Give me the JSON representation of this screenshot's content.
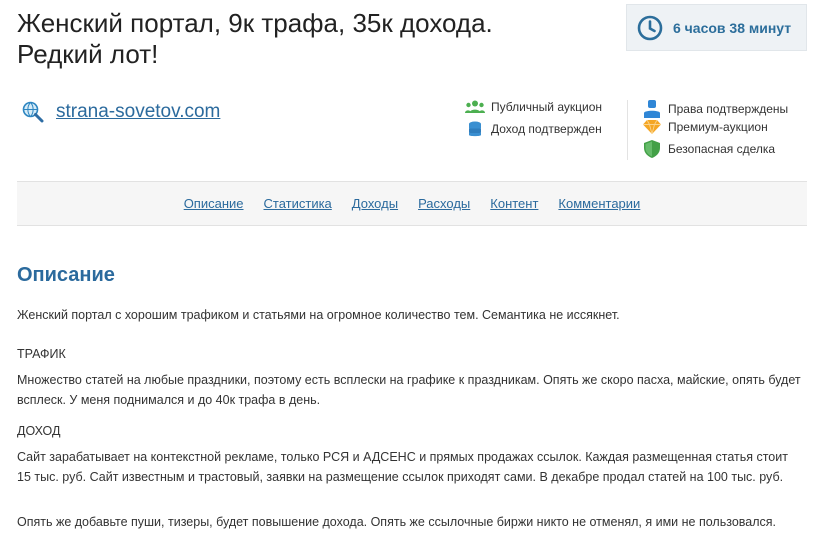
{
  "lot": {
    "title_line1": "Женский портал, 9к трафа, 35к дохода.",
    "title_line2": "Редкий лот!"
  },
  "timer": {
    "text": "6 часов 38 минут",
    "icon": "clock-icon"
  },
  "domain": {
    "link": "strana-sovetov.com",
    "icon": "globe-search-icon"
  },
  "features_left": [
    {
      "label": "Публичный аукцион",
      "icon": "users-icon"
    },
    {
      "label": "Доход подтвержден",
      "icon": "coins-icon"
    }
  ],
  "features_right": [
    {
      "label": "Права подтверждены",
      "icon": "user-icon"
    },
    {
      "label": "Премиум-аукцион",
      "icon": "diamond-icon"
    },
    {
      "label": "Безопасная сделка",
      "icon": "shield-icon"
    }
  ],
  "tabs": [
    "Описание",
    "Статистика",
    "Доходы",
    "Расходы",
    "Контент",
    "Комментарии"
  ],
  "description": {
    "heading": "Описание",
    "intro": "Женский портал с хорошим трафиком и статьями на огромное количество тем. Семантика не иссякнет.",
    "traffic_heading": "ТРАФИК",
    "traffic_text": "Множество статей на любые праздники, поэтому есть всплески на графике к праздникам. Опять же скоро пасха, майские, опять будет всплеск. У меня поднимался и до 40к трафа в день.",
    "income_heading": "ДОХОД",
    "income_text": "Сайт зарабатывает на контекстной рекламе, только РСЯ и АДСЕНС и прямых продажах ссылок. Каждая размещенная статья стоит 15 тыс. руб. Сайт известным и трастовый, заявки на размещение ссылок приходят сами. В декабре продал статей на 100 тыс. руб.",
    "outro": "Опять же добавьте пуши, тизеры, будет повышение дохода. Опять же ссылочные биржи никто не отменял, я ими не пользовался."
  },
  "colors": {
    "accent": "#2b6a9d",
    "timer_bg": "#eef2f5",
    "users_green": "#4caf50",
    "coins_blue": "#3a8fd1",
    "user_blue": "#2f86d6",
    "diamond_orange": "#f5a623",
    "shield_green": "#43a047"
  }
}
